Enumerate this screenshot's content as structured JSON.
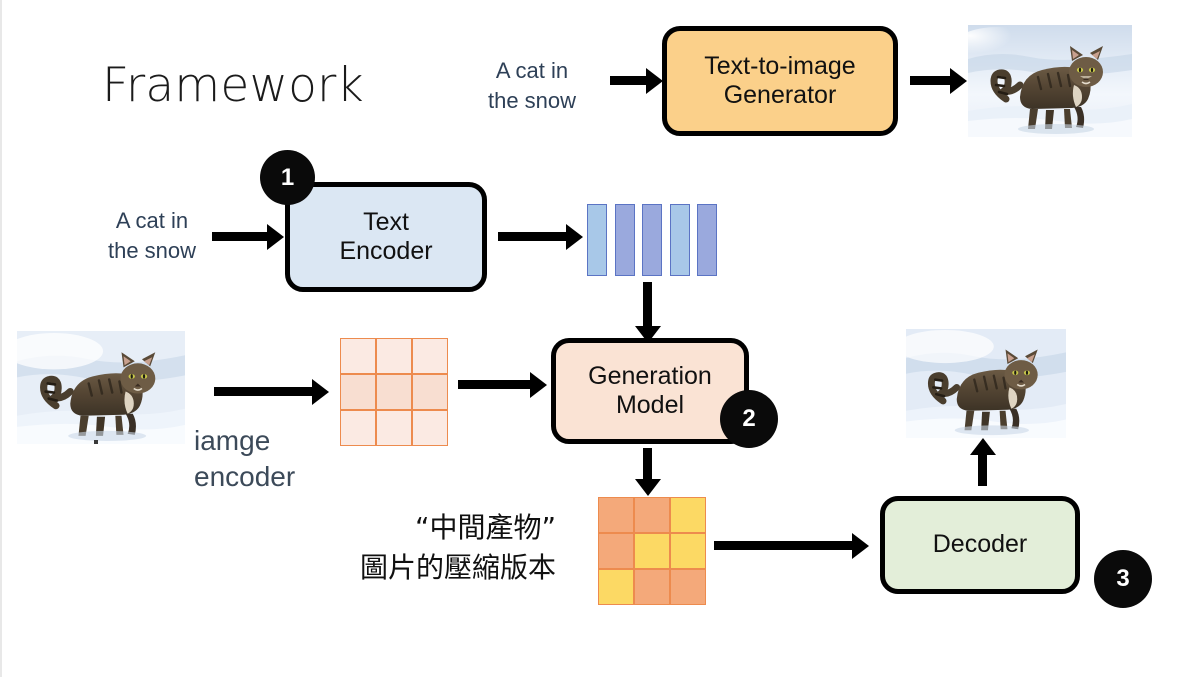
{
  "slide": {
    "title": "Framework",
    "background": "#ffffff"
  },
  "colors": {
    "text_to_image_box": "#fbd08a",
    "text_encoder_box": "#dbe7f3",
    "generation_model_box": "#fae3d4",
    "decoder_box": "#e3eed9",
    "badge": "#0a0a0a",
    "grid_border": "#ed8b4e",
    "token_light": "#a8c8e8",
    "token_dark": "#9aa9dd",
    "prompt_text": "#2e4057",
    "arrow": "#000000"
  },
  "top_flow": {
    "prompt": {
      "line1": "A cat in",
      "line2": "the snow"
    },
    "generator_box": {
      "line1": "Text-to-image",
      "line2": "Generator"
    },
    "output_image_alt": "cat-in-snow-photo"
  },
  "text_branch": {
    "prompt": {
      "line1": "A cat in",
      "line2": "the snow"
    },
    "encoder_box": {
      "line1": "Text",
      "line2": "Encoder"
    },
    "badge": "1",
    "tokens": [
      {
        "shade": "light"
      },
      {
        "shade": "dark"
      },
      {
        "shade": "dark"
      },
      {
        "shade": "light"
      },
      {
        "shade": "dark"
      }
    ]
  },
  "image_branch": {
    "input_image_alt": "cat-in-snow-photo",
    "caption": {
      "line1": "iamge",
      "line2": "encoder"
    },
    "latent_grid": [
      [
        "pale",
        "pale",
        "pale"
      ],
      [
        "pale2",
        "pale2",
        "pale2"
      ],
      [
        "pale",
        "pale",
        "pale"
      ]
    ]
  },
  "generation": {
    "box": {
      "line1": "Generation",
      "line2": "Model"
    },
    "badge": "2"
  },
  "latent_output": {
    "caption": {
      "line1": "“中間產物”",
      "line2": "圖片的壓縮版本"
    },
    "grid": [
      [
        "salmon",
        "salmon",
        "yellow"
      ],
      [
        "salmon",
        "yellow",
        "yellow"
      ],
      [
        "yellow",
        "salmon",
        "salmon"
      ]
    ]
  },
  "decoder": {
    "box": {
      "line1": "Decoder"
    },
    "badge": "3",
    "output_image_alt": "cat-in-snow-photo"
  }
}
